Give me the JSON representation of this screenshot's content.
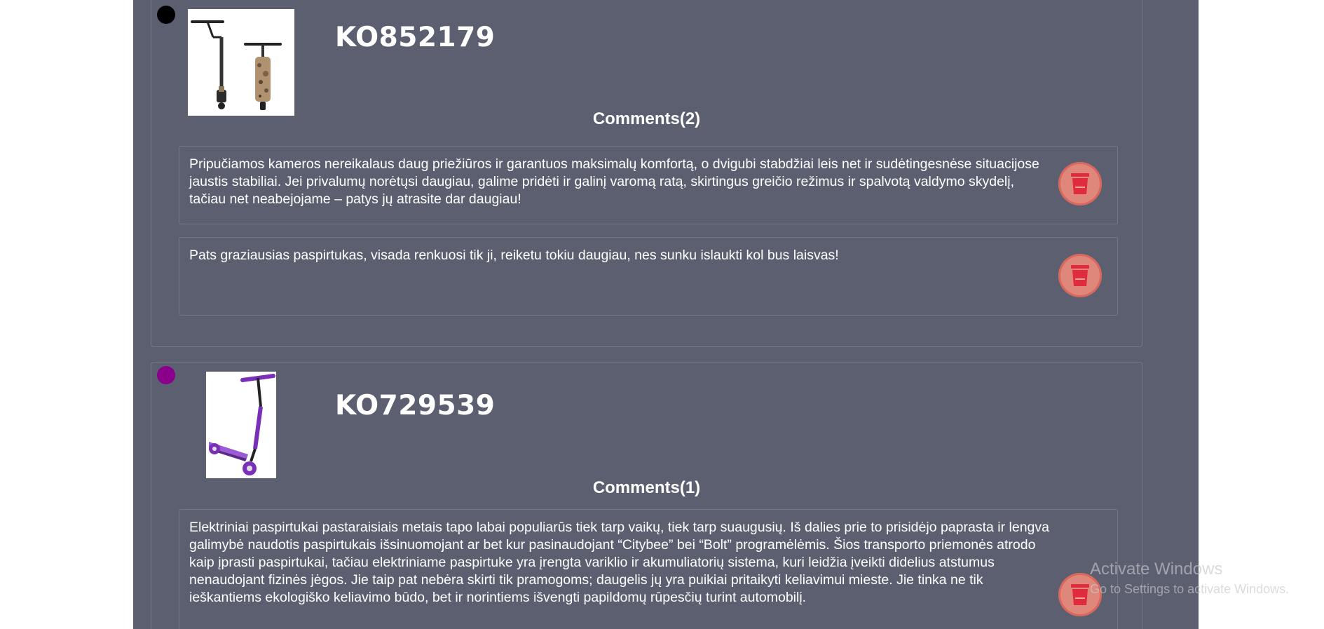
{
  "items": [
    {
      "code": "KO852179",
      "dot_color": "#000000",
      "image_icon": "black-camo-scooter-image",
      "comments_title": "Comments(2)",
      "comments": [
        "Pripučiamos kameros nereikalaus daug priežiūros ir garantuos maksimalų komfortą, o dvigubi stabdžiai leis net ir sudėtingesnėse situacijose jaustis stabiliai. Jei privalumų norėtųsi daugiau, galime pridėti ir galinį varomą ratą, skirtingus greičio režimus ir spalvotą valdymo skydelį, tačiau net neabejojame – patys jų atrasite dar daugiau!",
        "Pats graziausias paspirtukas, visada renkuosi tik ji, reiketu tokiu daugiau, nes sunku islaukti kol bus laisvas!"
      ]
    },
    {
      "code": "KO729539",
      "dot_color": "#8b008b",
      "image_icon": "purple-scooter-image",
      "comments_title": "Comments(1)",
      "comments": [
        "Elektriniai paspirtukai pastaraisiais metais tapo labai populiarūs tiek tarp vaikų, tiek tarp suaugusių. Iš dalies prie to prisidėjo paprasta ir lengva galimybė naudotis paspirtukais išsinuomojant ar bet kur pasinaudojant “Citybee” bei “Bolt” programėlėmis. Šios transporto priemonės atrodo kaip įprasti paspirtukai, tačiau elektriniame paspirtuke yra įrengta variklio ir akumuliatorių sistema, kuri leidžia įveikti didelius atstumus nenaudojant fizinės jėgos. Jie taip pat nebėra skirti tik pramogoms; daugelis jų yra puikiai pritaikyti keliavimui mieste. Jie tinka ne tik ieškantiems ekologiško keliavimo būdo, bet ir norintiems išvengti papildomų rūpesčių turint automobilį."
      ]
    }
  ],
  "delete_icon": "trash-icon",
  "colors": {
    "panel_bg": "#5b5f70",
    "delete_button": "#e0877c",
    "delete_icon": "#e02b3d"
  },
  "watermark": {
    "line1": "Activate Windows",
    "line2": "Go to Settings to activate Windows."
  }
}
